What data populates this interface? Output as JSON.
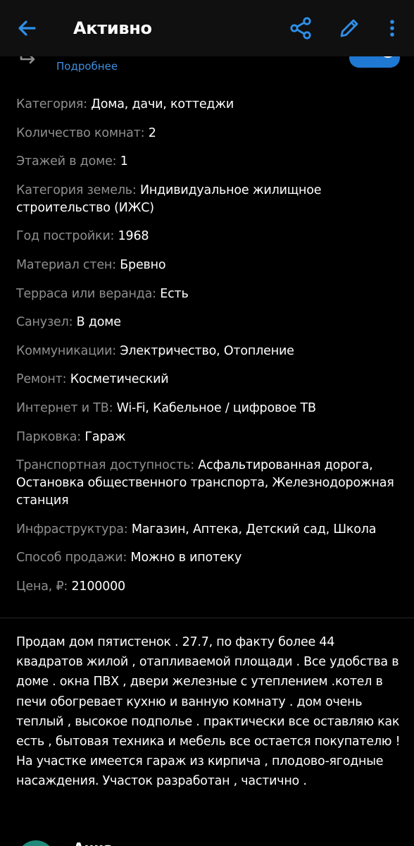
{
  "header": {
    "title": "Активно"
  },
  "top_peek": {
    "more_link": "Подробнее",
    "toggle_on": true
  },
  "details": [
    {
      "key": "Категория:",
      "value": "Дома, дачи, коттеджи"
    },
    {
      "key": "Количество комнат:",
      "value": "2"
    },
    {
      "key": "Этажей в доме:",
      "value": "1"
    },
    {
      "key": "Категория земель:",
      "value": "Индивидуальное жилищное строительство (ИЖС)"
    },
    {
      "key": "Год постройки:",
      "value": "1968"
    },
    {
      "key": "Материал стен:",
      "value": "Бревно"
    },
    {
      "key": "Терраса или веранда:",
      "value": "Есть"
    },
    {
      "key": "Санузел:",
      "value": "В доме"
    },
    {
      "key": "Коммуникации:",
      "value": "Электричество, Отопление"
    },
    {
      "key": "Ремонт:",
      "value": "Косметический"
    },
    {
      "key": "Интернет и ТВ:",
      "value": "Wi-Fi, Кабельное / цифровое ТВ"
    },
    {
      "key": "Парковка:",
      "value": "Гараж"
    },
    {
      "key": "Транспортная доступность:",
      "value": "Асфальтированная дорога, Остановка общественного транспорта, Железнодорожная станция"
    },
    {
      "key": "Инфраструктура:",
      "value": "Магазин, Аптека, Детский сад, Школа"
    },
    {
      "key": "Способ продажи:",
      "value": "Можно в ипотеку"
    },
    {
      "key": "Цена, ₽:",
      "value": "2100000"
    }
  ],
  "description": "Продам дом пятистенок . 27.7, по факту более 44 квадратов жилой , отапливаемой площади .  Все удобства в доме . окна  ПВХ , двери железные с утеплением .котел в печи обогревает кухню и ванную комнату . дом очень теплый , высокое подполье . практически все оставляю как есть , бытовая техника и мебель  все остается покупателю ! На участке имеется гараж из кирпича , плодово-ягодные насаждения. Участок разработан , частично .",
  "author": {
    "name": "Анна"
  },
  "colors": {
    "accent": "#2f8fe8",
    "background": "#000000",
    "header_bg": "#101010",
    "label": "#8f8f8f",
    "text": "#ffffff"
  },
  "icons": {
    "back": "arrow-left-icon",
    "share": "share-icon",
    "edit": "pencil-icon",
    "more": "more-vertical-icon",
    "peek": "turn-arrow-icon"
  }
}
